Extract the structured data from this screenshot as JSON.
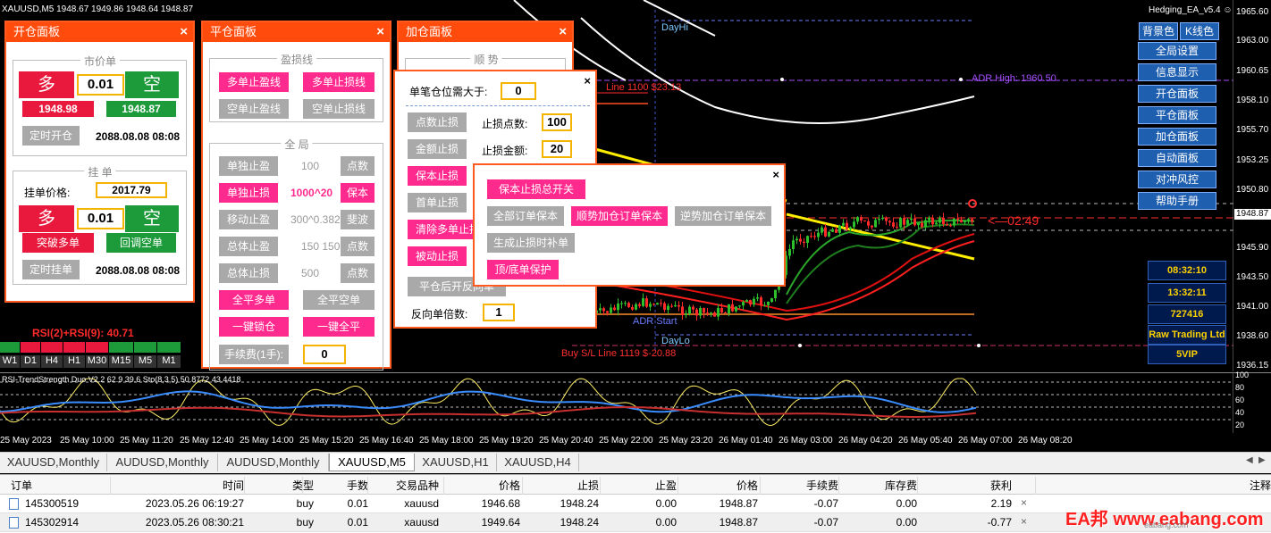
{
  "chart": {
    "symbol_header": "XAUUSD,M5  1948.67 1949.86 1948.64 1948.87",
    "ea_label": "Hedging_EA_v5.4",
    "price_scale": [
      "1965.60",
      "1963.00",
      "1960.65",
      "1958.10",
      "1955.70",
      "1953.25",
      "1950.80",
      "1948.87",
      "1945.90",
      "1943.50",
      "1941.00",
      "1938.60",
      "1936.15"
    ],
    "line_labels": {
      "dayhi": "DayHi",
      "adr_high": "ADR High: 1960.50",
      "dayLo": "DayLo",
      "adr_start": "ADR Start",
      "sell_sl": "Line 1100 $23.13",
      "buy_sl": "Buy S/L Line 1119 $-20.88",
      "countdown": "<—02:49"
    }
  },
  "time_axis": [
    "25 May 2023",
    "25 May 10:00",
    "25 May 11:20",
    "25 May 12:40",
    "25 May 14:00",
    "25 May 15:20",
    "25 May 16:40",
    "25 May 18:00",
    "25 May 19:20",
    "25 May 20:40",
    "25 May 22:00",
    "25 May 23:20",
    "26 May 01:40",
    "26 May 03:00",
    "26 May 04:20",
    "26 May 05:40",
    "26 May 07:00",
    "26 May 08:20"
  ],
  "indicator": {
    "label": "RSI-TrendStrength Duo V2.2 62.9 39.6  Sto(8,3,5) 50.8772 43.4418",
    "scale": [
      "100",
      "80",
      "60",
      "40",
      "20",
      "0"
    ],
    "rsi_label": "RSI(2)+RSI(9):  40.71",
    "timeframes": [
      "W1",
      "D1",
      "H4",
      "H1",
      "M30",
      "M15",
      "M5",
      "M1"
    ]
  },
  "open_panel": {
    "title": "开仓面板",
    "market_section": "市价单",
    "long_label": "多",
    "short_label": "空",
    "lots": "0.01",
    "bid": "1948.98",
    "ask": "1948.87",
    "timed_open_btn": "定时开仓",
    "timed_open_time": "2088.08.08 08:08",
    "pending_section": "挂 单",
    "pending_price_label": "挂单价格:",
    "pending_price": "2017.79",
    "pending_long": "多",
    "pending_short": "空",
    "pending_lots": "0.01",
    "breakout_btn": "突破多单",
    "pullback_btn": "回调空单",
    "timed_pending_btn": "定时挂单",
    "timed_pending_time": "2088.08.08 08:08"
  },
  "close_panel": {
    "title": "平仓面板",
    "sltp_section": "盈损线",
    "btn_buy_tp": "多单止盈线",
    "btn_buy_sl": "多单止损线",
    "btn_sell_tp": "空单止盈线",
    "btn_sell_sl": "空单止损线",
    "global_section": "全 局",
    "rows": [
      {
        "btn": "单独止盈",
        "val": "100",
        "unit": "点数"
      },
      {
        "btn": "单独止损",
        "val": "1000^20",
        "unit": "保本"
      },
      {
        "btn": "移动止盈",
        "val": "300^0.382",
        "unit": "斐波"
      },
      {
        "btn": "总体止盈",
        "val": "150 150",
        "unit": "点数"
      },
      {
        "btn": "总体止损",
        "val": "500",
        "unit": "点数"
      }
    ],
    "btn_close_buy": "全平多单",
    "btn_close_sell": "全平空单",
    "btn_lock": "一键锁仓",
    "btn_close_all": "一键全平",
    "fee_label": "手续费(1手):",
    "fee_value": "0"
  },
  "add_panel": {
    "title": "加仓面板",
    "trend_section": "顺 势"
  },
  "stop_popup": {
    "min_pos_label": "单笔仓位需大于:",
    "min_pos_value": "0",
    "btn_points_sl": "点数止损",
    "points_label": "止损点数:",
    "points_value": "100",
    "btn_amount_sl": "金额止损",
    "amount_label": "止损金额:",
    "amount_value": "20",
    "btn_breakeven": "保本止损",
    "btn_first": "首单止损",
    "btn_clear": "清除多单止损",
    "btn_passive": "被动止损",
    "btn_reverse": "平仓后开反向单",
    "reverse_mult_label": "反向单倍数:",
    "reverse_mult_value": "1"
  },
  "be_popup": {
    "btn_master": "保本止损总开关",
    "btn_all": "全部订单保本",
    "btn_trend": "顺势加仓订单保本",
    "btn_counter": "逆势加仓订单保本",
    "btn_gen": "生成止损时补单",
    "btn_topbottom": "顶/底单保护"
  },
  "right_menu": {
    "bg_btn": "背景色",
    "k_btn": "K线色",
    "items": [
      "全局设置",
      "信息显示",
      "开仓面板",
      "平仓面板",
      "加仓面板",
      "自动面板",
      "对冲风控",
      "帮助手册"
    ]
  },
  "info_boxes": [
    "08:32:10",
    "13:32:11",
    "727416",
    "Raw Trading Ltd",
    "5VIP"
  ],
  "tabs": [
    "XAUUSD,Monthly",
    "AUDUSD,Monthly",
    "AUDUSD,Monthly",
    "XAUUSD,M5",
    "XAUUSD,H1",
    "XAUUSD,H4"
  ],
  "active_tab": "XAUUSD,M5",
  "table": {
    "headers": [
      "订单",
      "时间",
      "类型",
      "手数",
      "交易品种",
      "价格",
      "止损",
      "止盈",
      "价格",
      "手续费",
      "库存费",
      "获利",
      "注释"
    ],
    "rows": [
      [
        "145300519",
        "2023.05.26 06:19:27",
        "buy",
        "0.01",
        "xauusd",
        "1946.68",
        "1948.24",
        "0.00",
        "1948.87",
        "-0.07",
        "0.00",
        "2.19"
      ],
      [
        "145302914",
        "2023.05.26 08:30:21",
        "buy",
        "0.01",
        "xauusd",
        "1949.64",
        "1948.24",
        "0.00",
        "1948.87",
        "-0.07",
        "0.00",
        "-0.77"
      ]
    ]
  },
  "watermark": "EA邦 www.eabang.com",
  "watermark_sub": "eabang.com"
}
